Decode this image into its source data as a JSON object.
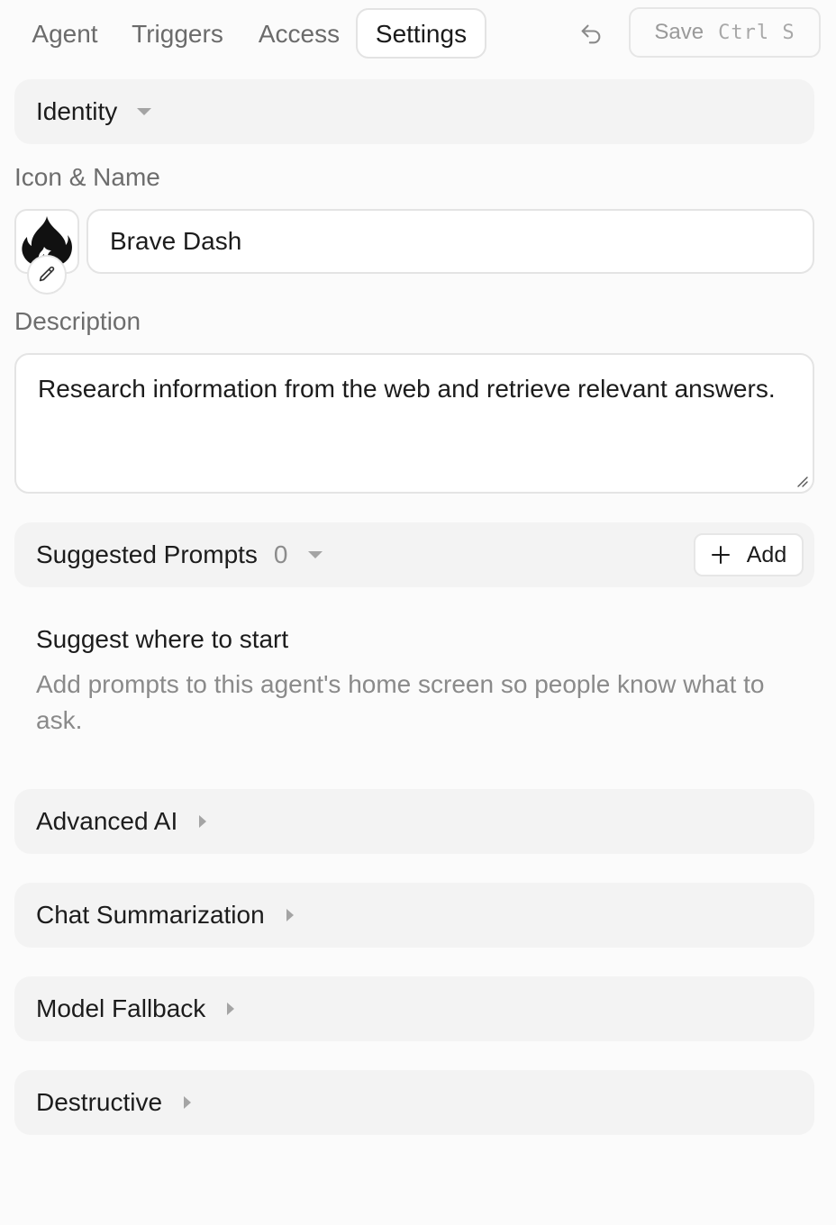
{
  "tabs": [
    {
      "label": "Agent",
      "active": false
    },
    {
      "label": "Triggers",
      "active": false
    },
    {
      "label": "Access",
      "active": false
    },
    {
      "label": "Settings",
      "active": true
    }
  ],
  "toolbar": {
    "undo_icon": "undo-icon",
    "save_label": "Save",
    "save_shortcut": "Ctrl S"
  },
  "identity": {
    "section_title": "Identity",
    "icon_name_label": "Icon & Name",
    "agent_icon": "fire-icon",
    "edit_icon": "pencil-icon",
    "name_value": "Brave Dash",
    "description_label": "Description",
    "description_value": "Research information from the web and retrieve relevant answers."
  },
  "suggested_prompts": {
    "title": "Suggested Prompts",
    "count": "0",
    "add_label": "Add",
    "empty_title": "Suggest where to start",
    "empty_description": "Add prompts to this agent's home screen so people know what to ask."
  },
  "sections": {
    "advanced_ai": "Advanced AI",
    "chat_summarization": "Chat Summarization",
    "model_fallback": "Model Fallback",
    "destructive": "Destructive"
  },
  "colors": {
    "background": "#fbfbfb",
    "section_bg": "#f3f3f3",
    "border": "#e4e4e4",
    "muted_text": "#8a8a8a"
  }
}
